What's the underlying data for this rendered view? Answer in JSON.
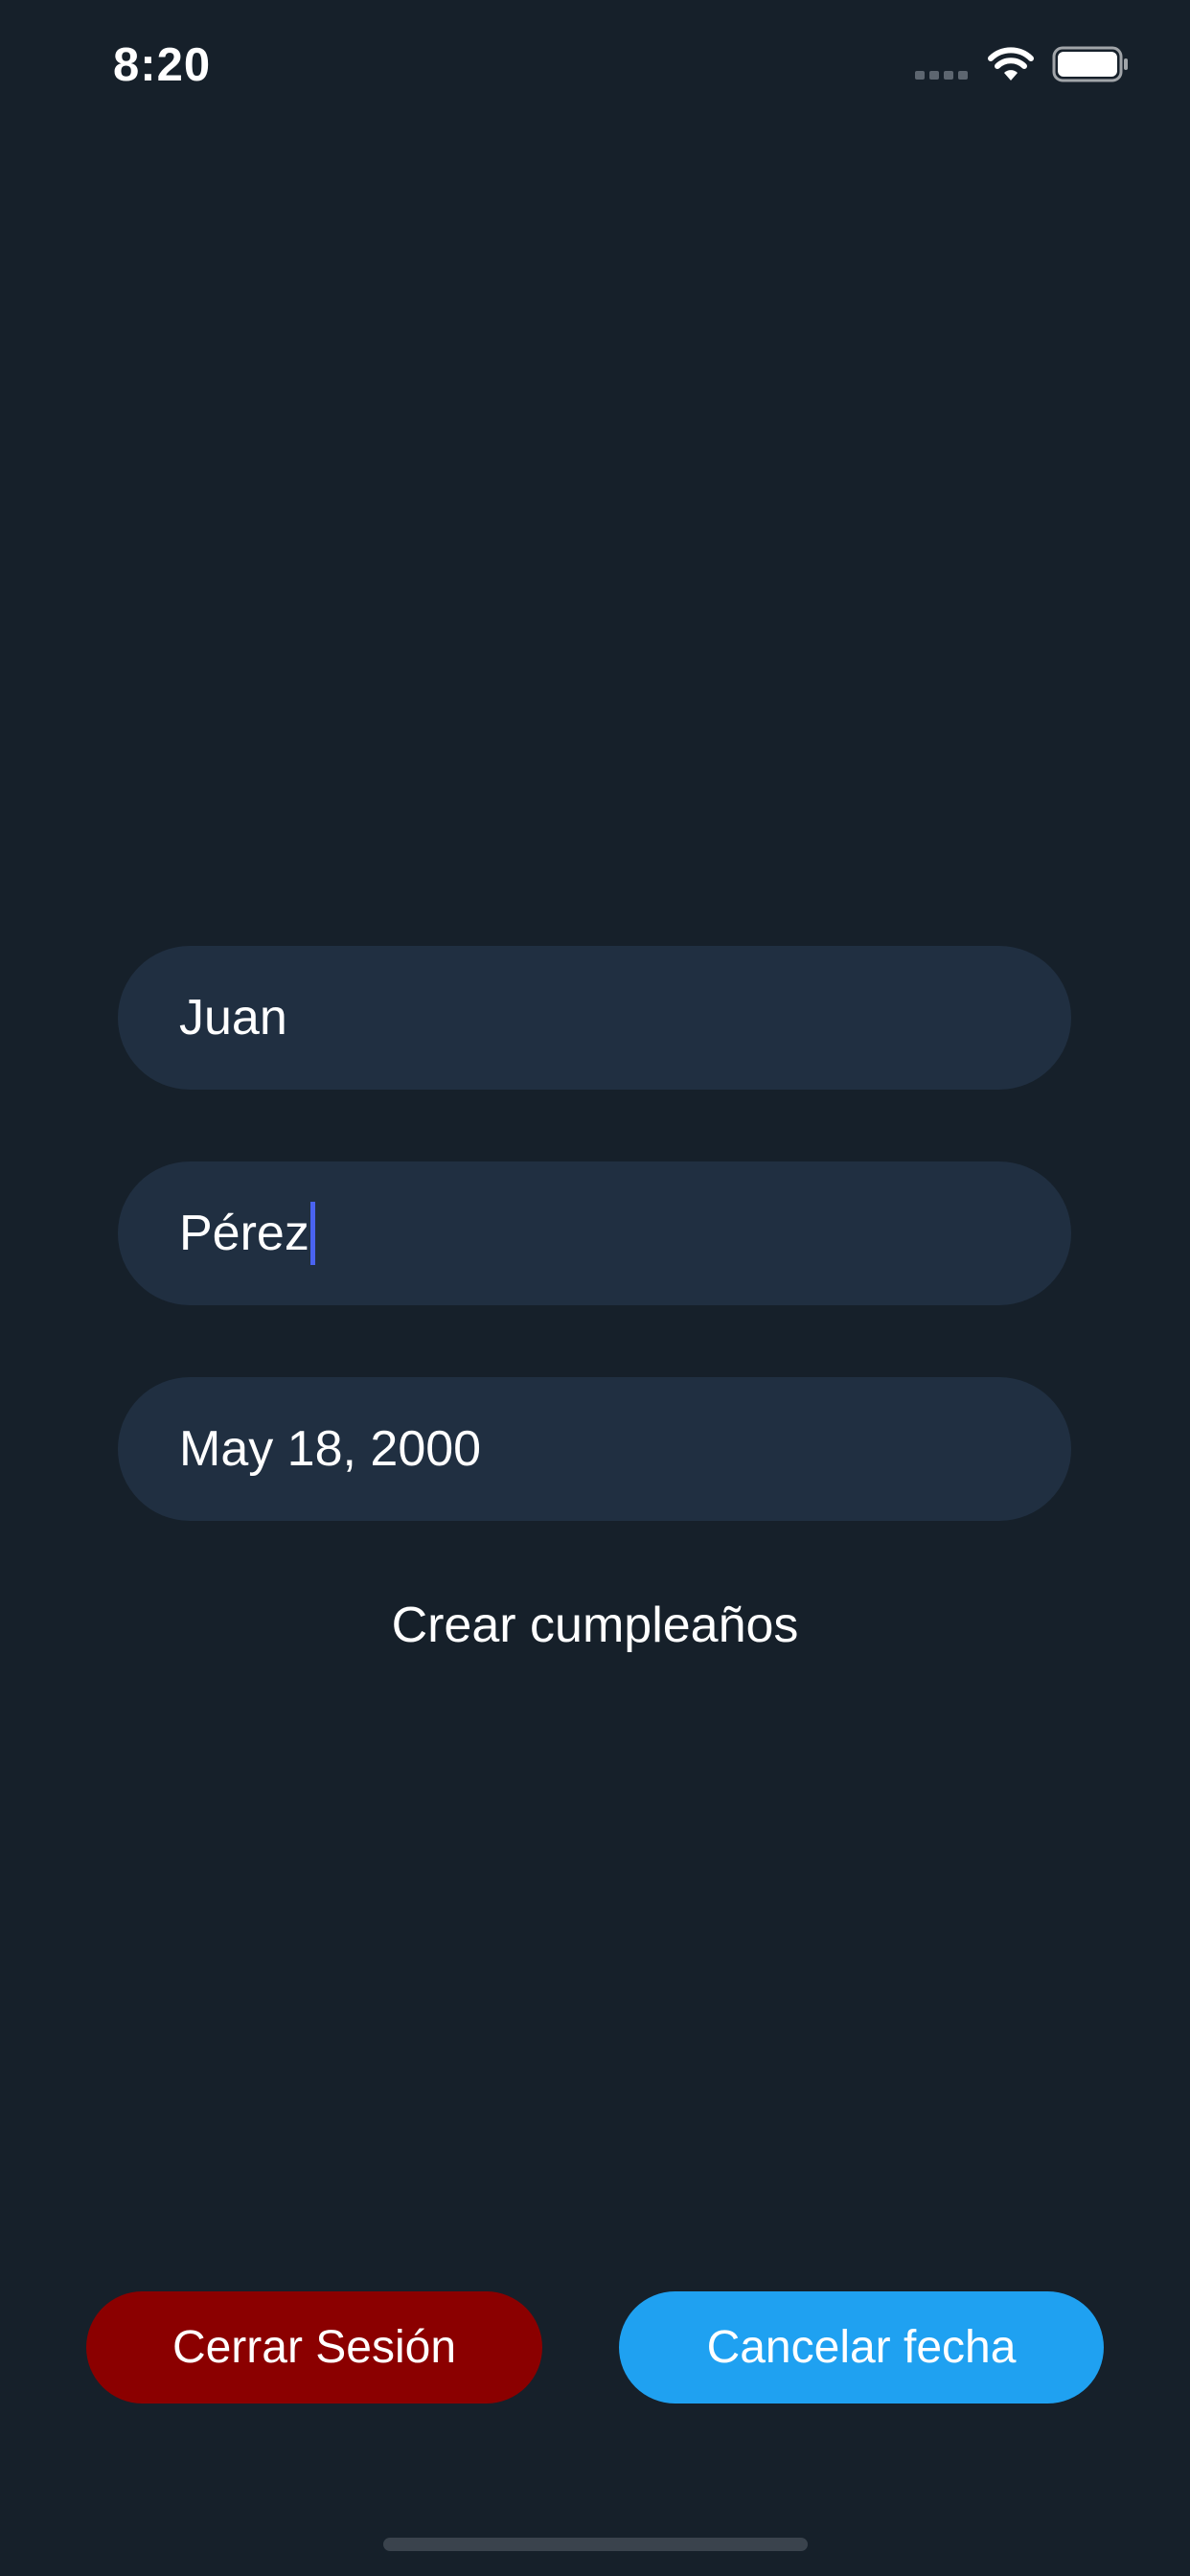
{
  "status_bar": {
    "time": "8:20",
    "icons": [
      "cellular-signal-icon",
      "wifi-icon",
      "battery-icon"
    ]
  },
  "form": {
    "first_name_value": "Juan",
    "last_name_value": "Pérez",
    "birth_date_value": "May 18, 2000",
    "create_label": "Crear cumpleaños"
  },
  "actions": {
    "logout_label": "Cerrar Sesión",
    "cancel_label": "Cancelar fecha"
  },
  "colors": {
    "background": "#16202a",
    "field_background": "#202f41",
    "logout_button": "#8b0000",
    "cancel_button": "#1fa1f1",
    "caret": "#4a63f0"
  }
}
